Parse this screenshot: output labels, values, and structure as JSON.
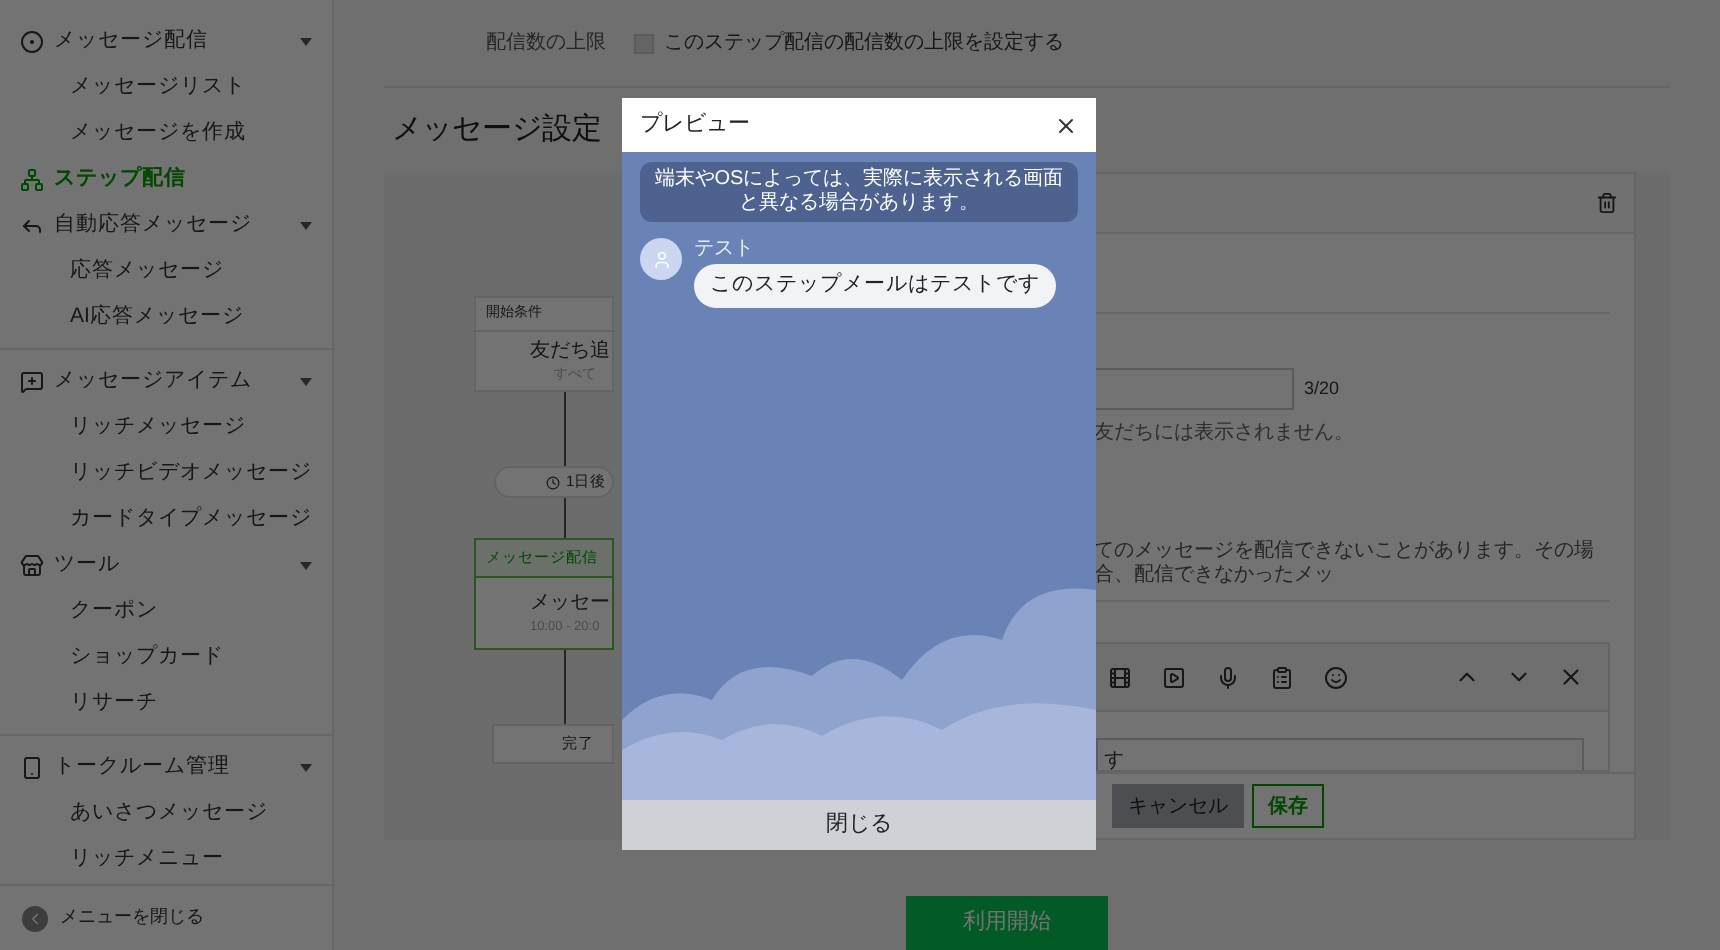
{
  "sidebar": {
    "items": [
      {
        "label": "メッセージ配信",
        "selected": false,
        "expanded": true,
        "children": [
          {
            "label": "メッセージリスト",
            "selected": false
          },
          {
            "label": "メッセージを作成",
            "selected": false
          }
        ]
      },
      {
        "label": "ステップ配信",
        "selected": true
      },
      {
        "label": "自動応答メッセージ",
        "selected": false,
        "expanded": true,
        "children": [
          {
            "label": "応答メッセージ",
            "selected": false
          },
          {
            "label": "AI応答メッセージ",
            "selected": false
          }
        ]
      },
      {
        "label": "メッセージアイテム",
        "selected": false,
        "expanded": true,
        "children": [
          {
            "label": "リッチメッセージ",
            "selected": false
          },
          {
            "label": "リッチビデオメッセージ",
            "selected": false
          },
          {
            "label": "カードタイプメッセージ",
            "selected": false
          }
        ]
      },
      {
        "label": "ツール",
        "selected": false,
        "expanded": true,
        "children": [
          {
            "label": "クーポン",
            "selected": false
          },
          {
            "label": "ショップカード",
            "selected": false
          },
          {
            "label": "リサーチ",
            "selected": false
          }
        ]
      },
      {
        "label": "トークルーム管理",
        "selected": false,
        "expanded": true,
        "children": [
          {
            "label": "あいさつメッセージ",
            "selected": false
          },
          {
            "label": "リッチメニュー",
            "selected": false
          }
        ]
      }
    ],
    "collapse": "メニューを閉じる"
  },
  "limit": {
    "label": "配信数の上限",
    "checkbox": {
      "label": "このステップ配信の配信数の上限を設定する",
      "checked": false
    }
  },
  "section_title": "メッセージ設定",
  "flow": {
    "start": {
      "header": "開始条件",
      "title": "友だち追",
      "subtitle": "すべて"
    },
    "wait": "1日後",
    "message": {
      "header": "メッセージ配信",
      "title": "メッセー",
      "time": "10:00 - 20:0",
      "selected": true
    },
    "end": "完了"
  },
  "editor": {
    "counter": "3/20",
    "hint": "友だちには表示されません。",
    "notice": "てのメッセージを配信できないことがあります。その場合、配信できなかったメッ",
    "text": "す",
    "buttons": [
      {
        "label": "キャンセル",
        "kind": "secondary"
      },
      {
        "label": "保存",
        "kind": "primary"
      }
    ]
  },
  "start_button": "利用開始",
  "preview": {
    "title": "プレビュー",
    "notice": "端末やOSによっては、実際に表示される画面と異なる場合があります。",
    "sender": "テスト",
    "message": "このステップメールはテストです",
    "close": "閉じる"
  }
}
